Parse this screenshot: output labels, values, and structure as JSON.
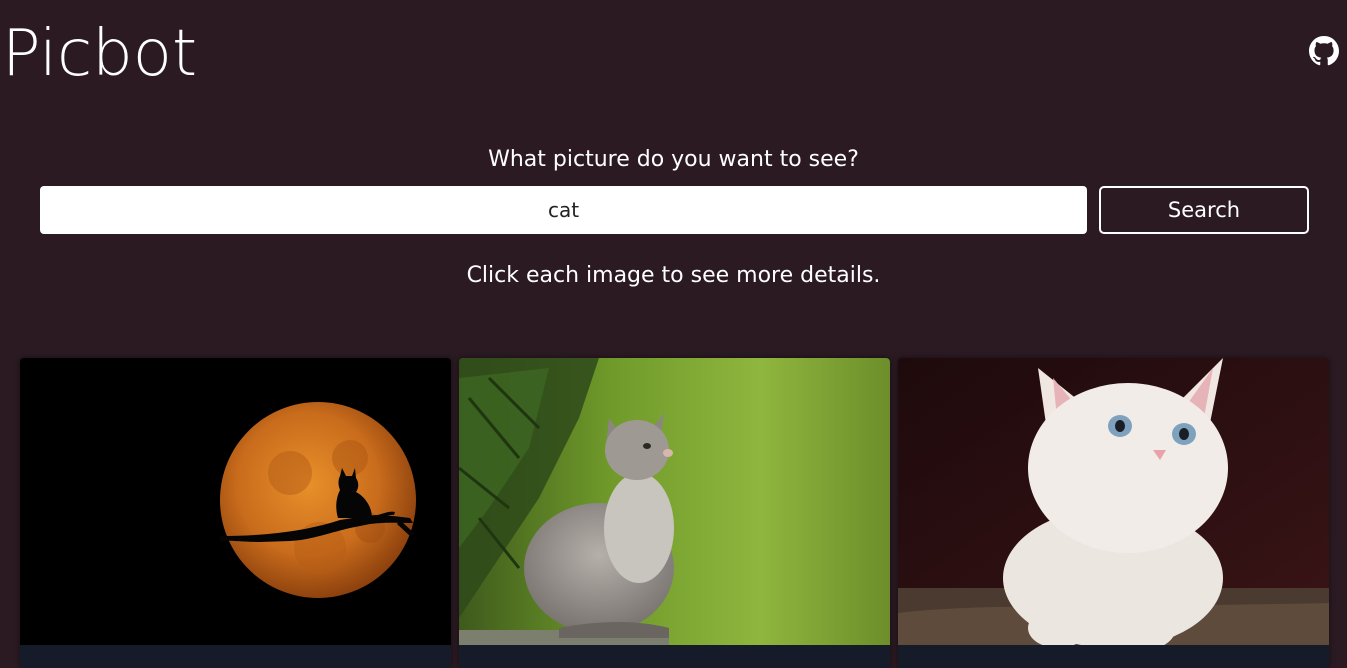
{
  "app": {
    "title": "Picbot"
  },
  "header": {
    "github_icon": "github-icon"
  },
  "search": {
    "prompt": "What picture do you want to see?",
    "value": "cat",
    "button_label": "Search"
  },
  "hint": "Click each image to see more details.",
  "results": [
    {
      "subject": "cat-silhouette-moon"
    },
    {
      "subject": "grey-kitten-in-grass"
    },
    {
      "subject": "white-kitten"
    }
  ],
  "colors": {
    "background": "#2b1a22",
    "text": "#ffffff",
    "input_bg": "#ffffff"
  }
}
